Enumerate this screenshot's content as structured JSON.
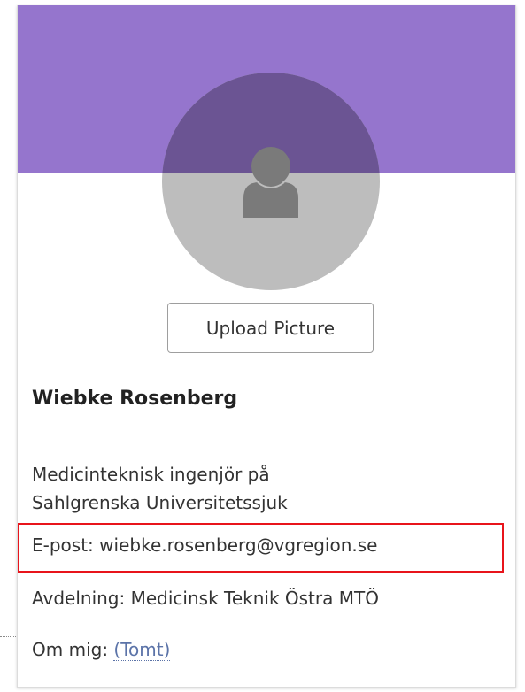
{
  "profile": {
    "upload_button_label": "Upload Picture",
    "name": "Wiebke Rosenberg",
    "title_line_1": "Medicinteknisk ingenjör på",
    "title_line_2": "Sahlgrenska Universitetssjuk",
    "email_label": "E-post:",
    "email_value": "wiebke.rosenberg@vgregion.se",
    "department_label": "Avdelning:",
    "department_value": "Medicinsk Teknik Östra MTÖ",
    "about_label": "Om mig:",
    "about_value": "(Tomt)"
  },
  "colors": {
    "banner": "#9575cd",
    "highlight_border": "#e8141b",
    "link": "#5b73a8"
  },
  "icons": {
    "avatar": "person-placeholder-icon"
  }
}
